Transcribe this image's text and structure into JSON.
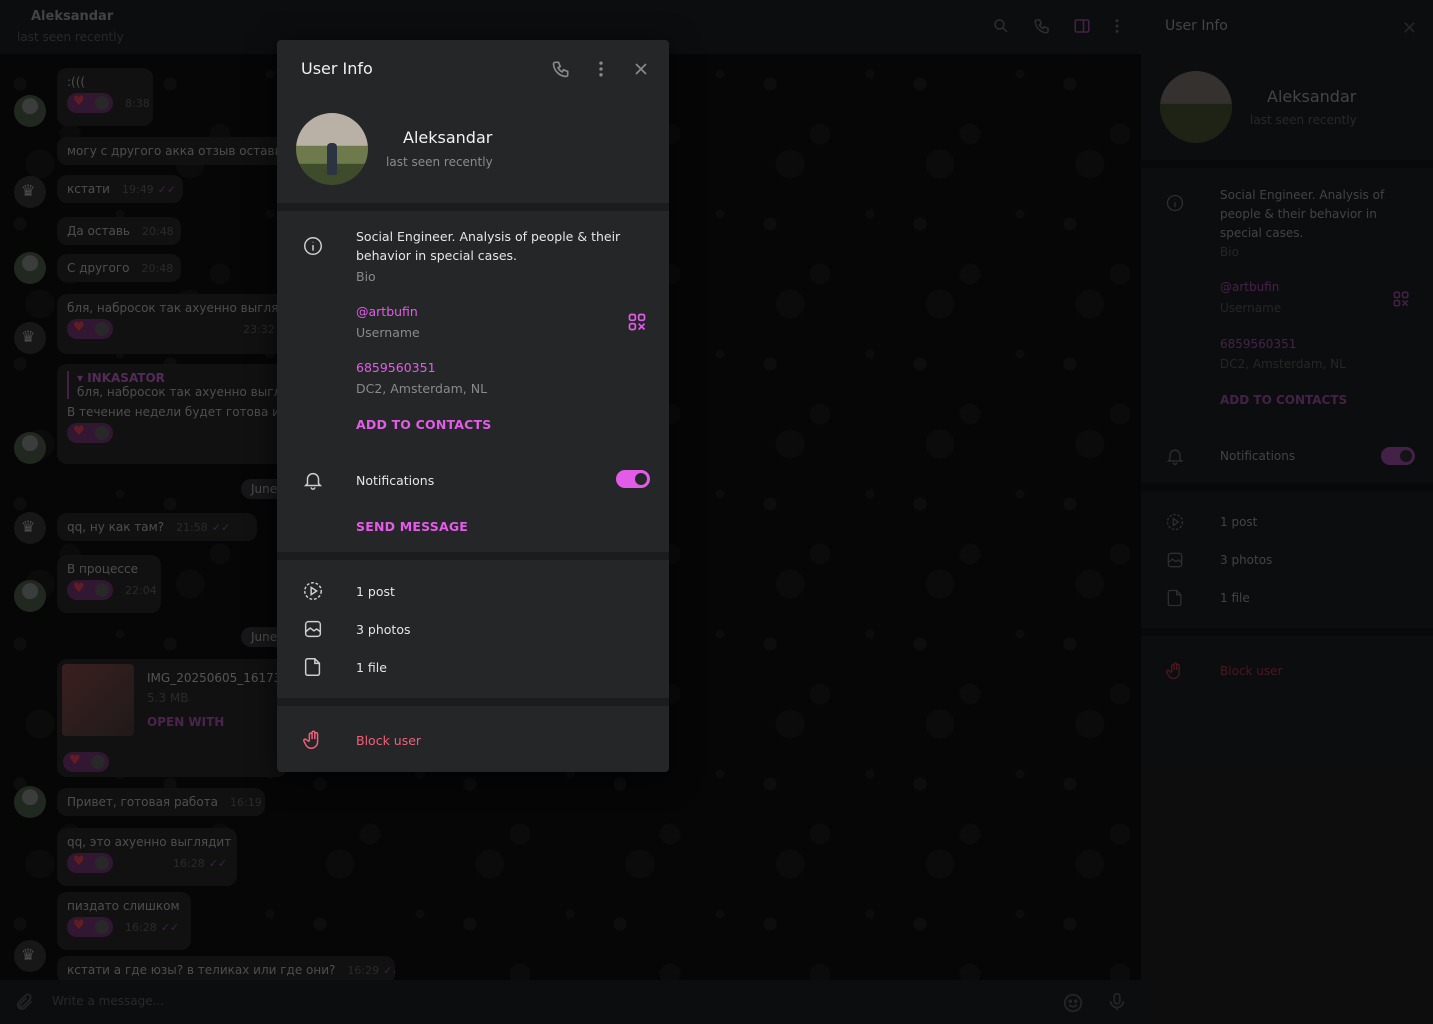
{
  "chat": {
    "name": "Aleksandar",
    "status": "last seen recently",
    "input_placeholder": "Write a message...",
    "messages": [
      {
        "text": ":(((",
        "time": "8:38"
      },
      {
        "text": "могу с другого акка отзыв остави",
        "time": ""
      },
      {
        "text": "кстати",
        "time": "19:49"
      },
      {
        "text": "Да оставь",
        "time": "20:48"
      },
      {
        "text": "С другого",
        "time": "20:48"
      },
      {
        "text": "бля, набросок так ахуенно выгляд",
        "time": "23:32"
      },
      {
        "text": "▾ INKASATOR",
        "time": ""
      },
      {
        "text": "бля, набросок так ахуенно выгл",
        "time": ""
      },
      {
        "text": "В течение недели будет готова и г",
        "time": ""
      },
      {
        "text": "June",
        "time": ""
      },
      {
        "text": "qq, ну как там?",
        "time": "21:58"
      },
      {
        "text": "В процессе",
        "time": "22:04"
      },
      {
        "text": "June",
        "time": ""
      },
      {
        "text": "IMG_20250605_16173",
        "time": ""
      },
      {
        "text": "5.3 MB",
        "time": ""
      },
      {
        "text": "OPEN WITH",
        "time": ""
      },
      {
        "text": "Привет, готовая работа",
        "time": "16:19"
      },
      {
        "text": "qq, это ахуенно выглядит",
        "time": "16:28"
      },
      {
        "text": "пиздато слишком",
        "time": "16:28"
      },
      {
        "text": "кстати а где юзы? в теликах или где они?",
        "time": "16:29"
      }
    ]
  },
  "side_panel": {
    "title": "User Info",
    "name": "Aleksandar",
    "status": "last seen recently",
    "bio": "Social Engineer. Analysis of people & their behavior in special cases.",
    "bio_label": "Bio",
    "username": "@artbufin",
    "username_label": "Username",
    "phone": "6859560351",
    "dc": "DC2, Amsterdam, NL",
    "add_contacts": "ADD TO CONTACTS",
    "notifications": "Notifications",
    "posts": "1 post",
    "photos": "3 photos",
    "files": "1 file",
    "block": "Block user"
  },
  "modal": {
    "title": "User Info",
    "name": "Aleksandar",
    "status": "last seen recently",
    "bio": "Social Engineer. Analysis of people & their behavior in special cases.",
    "bio_label": "Bio",
    "username": "@artbufin",
    "username_label": "Username",
    "phone": "6859560351",
    "dc": "DC2, Amsterdam, NL",
    "add_contacts": "ADD TO CONTACTS",
    "notifications": "Notifications",
    "notifications_on": true,
    "send_message": "SEND MESSAGE",
    "posts": "1 post",
    "photos": "3 photos",
    "files": "1 file",
    "block": "Block user"
  },
  "colors": {
    "accent": "#e35ce8",
    "danger": "#f0607a",
    "panel_bg": "#252628"
  }
}
